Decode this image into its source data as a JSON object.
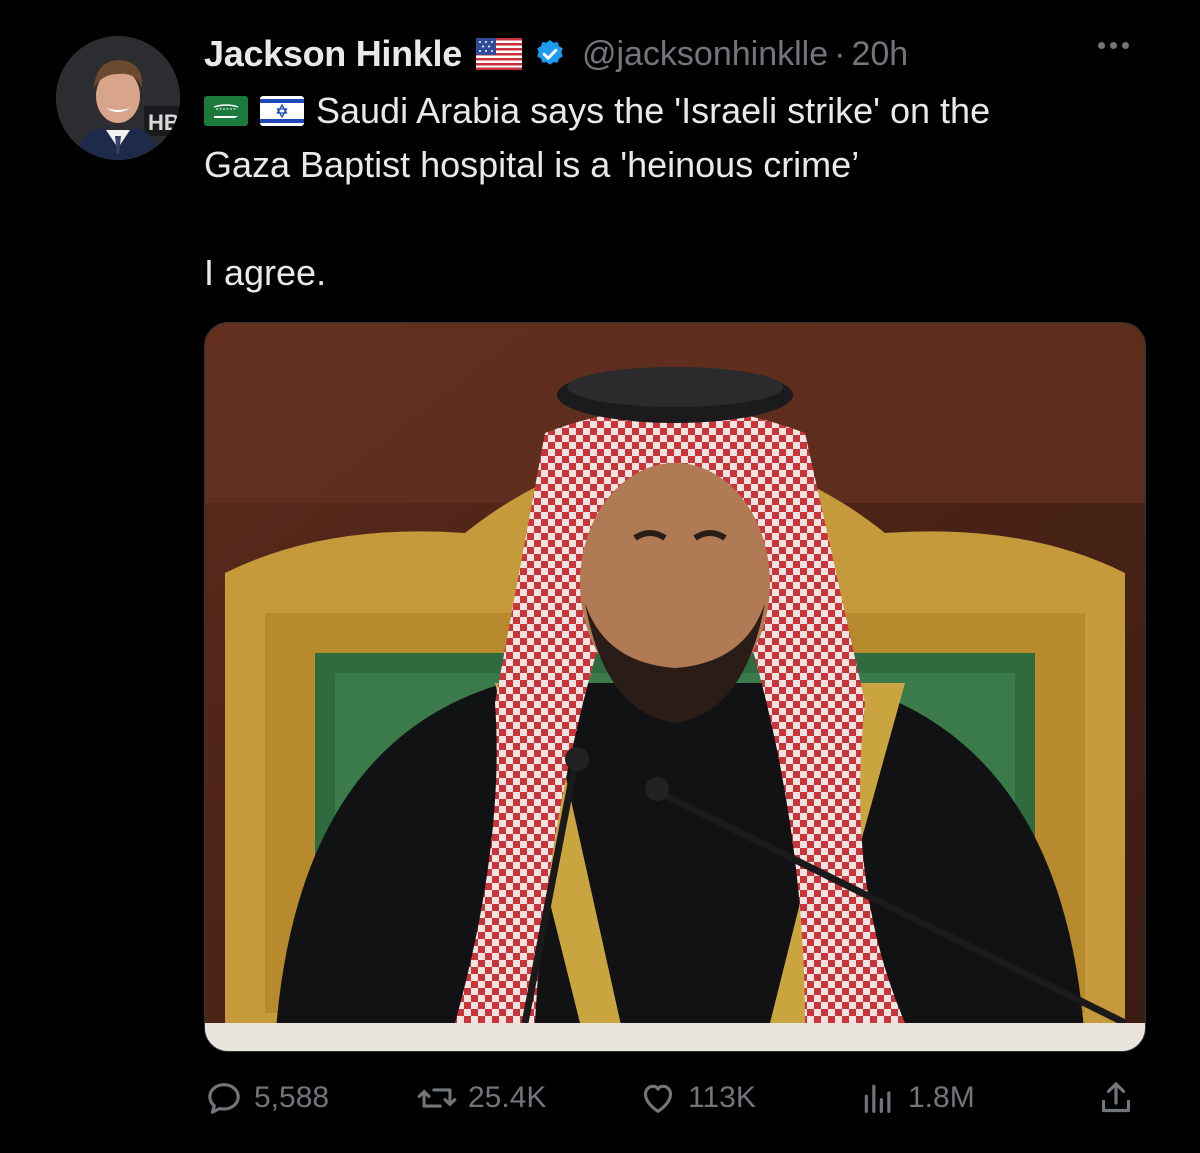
{
  "author": {
    "display_name": "Jackson Hinkle",
    "handle": "@jacksonhinklle",
    "separator": "·",
    "time": "20h",
    "avatar_text": "HB",
    "verified_color": "#1d9bf0"
  },
  "tweet": {
    "line1": "Saudi Arabia says the 'Israeli strike' on the",
    "line2": "Gaza Baptist hospital is a 'heinous crime’",
    "line3": "I agree.",
    "flags": [
      "saudi-arabia-flag",
      "israel-flag"
    ]
  },
  "actions": {
    "replies": "5,588",
    "reposts": "25.4K",
    "likes": "113K",
    "views": "1.8M"
  },
  "colors": {
    "background": "#000000",
    "text": "#e7e9ea",
    "muted": "#71767b",
    "accent": "#1d9bf0"
  }
}
